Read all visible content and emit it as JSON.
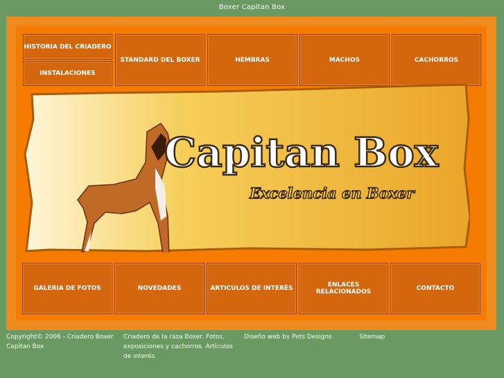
{
  "page": {
    "title": "Boxer Capitan Box"
  },
  "nav_top": [
    "HISTORIA DEL CRIADERO",
    "INSTALACIONES",
    "STANDARD DEL BOXER",
    "HEMBRAS",
    "MACHOS",
    "CACHORROS"
  ],
  "banner": {
    "title": "Capitan Box",
    "subtitle": "Excelencia en Boxer"
  },
  "nav_bottom": [
    "GALERIA DE FOTOS",
    "NOVEDADES",
    "ARTICULOS DE INTERÉS",
    "ENLACES RELACIONADOS",
    "CONTACTO"
  ],
  "footer": {
    "copyright": "Copyright© 2006 - Criadero Boxer Capitan Box",
    "description": "Criadero de la raza Boxer. Fotos, exposiciones y cachorros. Articulos de interés.",
    "design": "Diseño web by Pets Designs",
    "sitemap": "Sitemap"
  },
  "colors": {
    "background": "#6a9a62",
    "frame": "#f08c1e",
    "button": "#d4660e",
    "banner": "#f0b530"
  }
}
